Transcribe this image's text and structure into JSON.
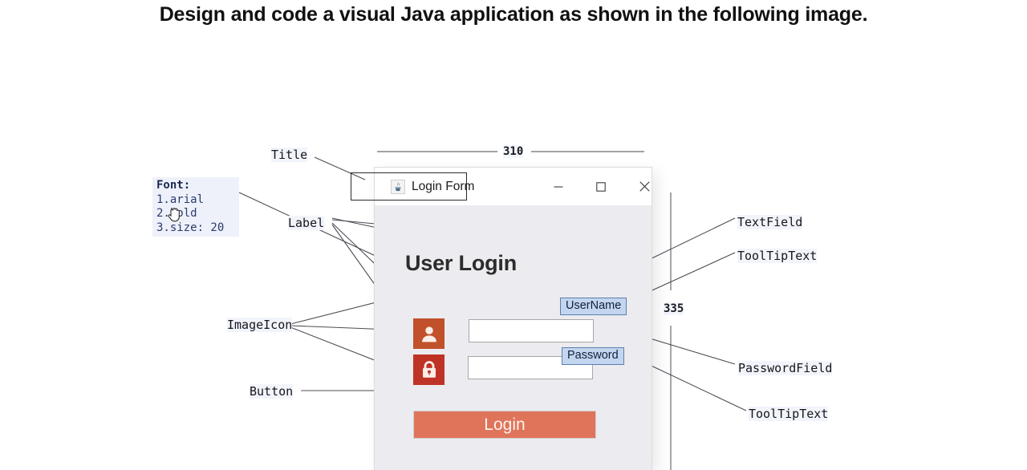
{
  "heading": {
    "text": "Design and code a visual Java application as shown in the following image."
  },
  "font_note": {
    "title": "Font:",
    "line1": "1.arial",
    "line2": "2.bold",
    "line3": "3.size: 20"
  },
  "dimensions": {
    "width_label": "310",
    "height_label": "335"
  },
  "window": {
    "title": "Login Form",
    "icon": "java-cup-icon",
    "minimize_label": "—",
    "maximize_label": "□",
    "close_label": "✕",
    "heading": "User Login",
    "username_field_value": "",
    "password_field_value": "",
    "username_tooltip": "UserName",
    "password_tooltip": "Password",
    "login_button_label": "Login",
    "body_color": "#ecebef",
    "button_color": "#e0745a",
    "user_icon_color": "#c0512b",
    "lock_icon_color": "#bf3326"
  },
  "annotations": {
    "title": "Title",
    "label": "Label",
    "image_icon": "ImageIcon",
    "button": "Button",
    "text_field": "TextField",
    "tooltip_text_top": "ToolTipText",
    "password_field": "PasswordField",
    "tooltip_text_bottom": "ToolTipText"
  }
}
